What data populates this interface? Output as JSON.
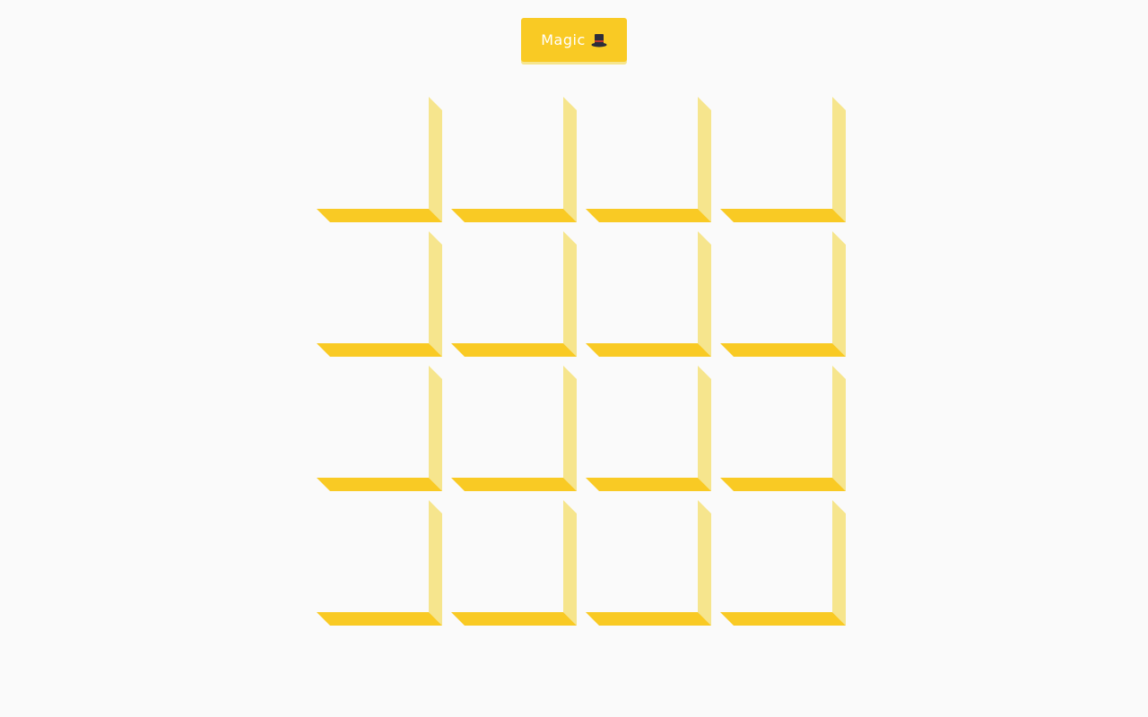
{
  "magic_button": {
    "label": "Magic",
    "icon": "top-hat-icon"
  },
  "grid": {
    "rows": 4,
    "columns": 4,
    "box_count": 16
  },
  "colors": {
    "background": "#fafafa",
    "accent": "#f9ca24",
    "accent_light": "#f6e58d",
    "button_text": "#ffffff"
  }
}
